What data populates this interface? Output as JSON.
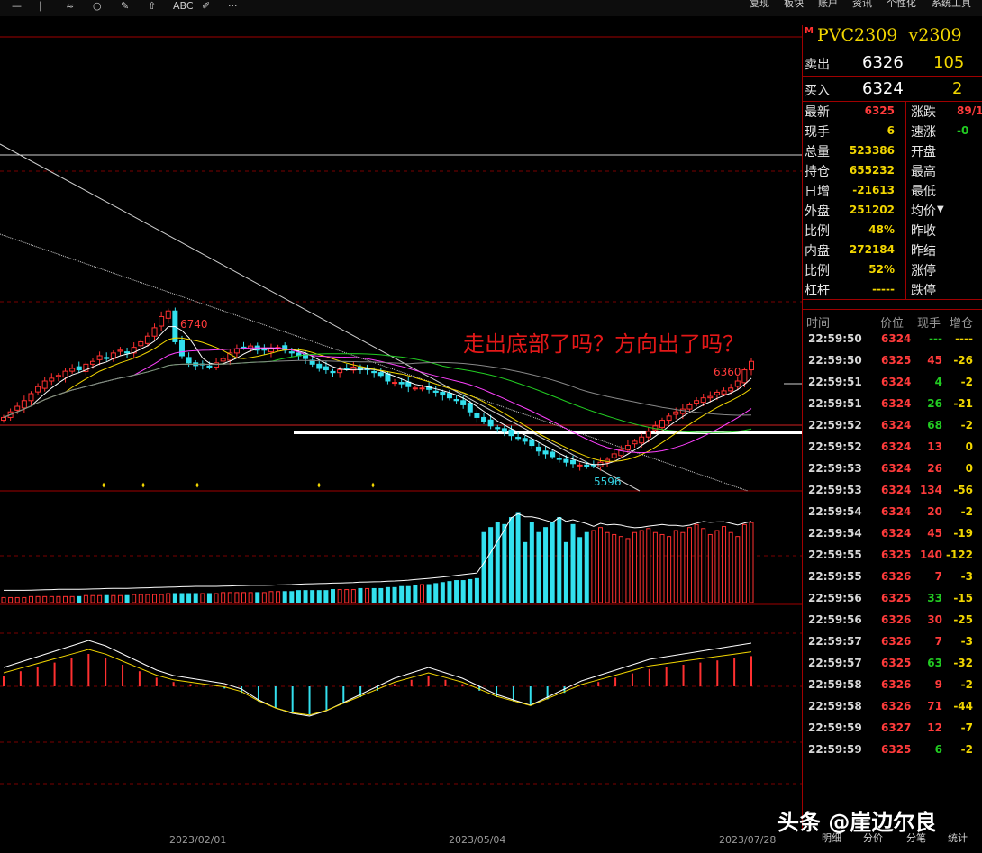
{
  "toolbar": {
    "icons": [
      "minus-icon",
      "draw-line-icon",
      "ellipse-icon",
      "wave-line-icon",
      "arrow-up-icon",
      "text-abc-icon",
      "pencil-icon",
      "more-icon"
    ],
    "abc_label": "ABC",
    "more_label": "···",
    "menu": [
      "复现",
      "板块",
      "账户",
      "资讯",
      "个性化",
      "系统工具"
    ]
  },
  "quote": {
    "flag": "M",
    "symbol": "PVC2309",
    "contract": "v2309",
    "sell_label": "卖出",
    "sell_price": "6326",
    "sell_vol": "105",
    "buy_label": "买入",
    "buy_price": "6324",
    "buy_vol": "2",
    "fields_left": [
      {
        "label": "最新",
        "value": "6325",
        "color": "#ff3b3b"
      },
      {
        "label": "现手",
        "value": "6",
        "color": "#f2d600"
      },
      {
        "label": "总量",
        "value": "523386",
        "color": "#f2d600"
      },
      {
        "label": "持仓",
        "value": "655232",
        "color": "#f2d600"
      },
      {
        "label": "日增",
        "value": "-21613",
        "color": "#f2d600"
      },
      {
        "label": "外盘",
        "value": "251202",
        "color": "#f2d600"
      },
      {
        "label": "比例",
        "value": "48%",
        "color": "#f2d600"
      },
      {
        "label": "内盘",
        "value": "272184",
        "color": "#f2d600"
      },
      {
        "label": "比例",
        "value": "52%",
        "color": "#f2d600"
      },
      {
        "label": "杠杆",
        "value": "-----",
        "color": "#f2d600"
      }
    ],
    "fields_right": [
      {
        "label": "涨跌",
        "value": "89/1",
        "color": "#ff3b3b"
      },
      {
        "label": "速涨",
        "value": "-0",
        "color": "#22cc22"
      },
      {
        "label": "开盘",
        "value": ""
      },
      {
        "label": "最高",
        "value": ""
      },
      {
        "label": "最低",
        "value": ""
      },
      {
        "label": "均价",
        "value": ""
      },
      {
        "label": "昨收",
        "value": ""
      },
      {
        "label": "昨结",
        "value": ""
      },
      {
        "label": "涨停",
        "value": ""
      },
      {
        "label": "跌停",
        "value": ""
      }
    ]
  },
  "ticks": {
    "headers": [
      "时间",
      "价位",
      "现手",
      "增仓"
    ],
    "rows": [
      {
        "time": "22:59:50",
        "price": "6324",
        "vol": "---",
        "chg": "----",
        "vc": "#22cc22",
        "cc": "#f2d600"
      },
      {
        "time": "22:59:50",
        "price": "6325",
        "vol": "45",
        "chg": "-26",
        "vc": "#ff3b3b",
        "cc": "#f2d600"
      },
      {
        "time": "22:59:51",
        "price": "6324",
        "vol": "4",
        "chg": "-2",
        "vc": "#22cc22",
        "cc": "#f2d600"
      },
      {
        "time": "22:59:51",
        "price": "6324",
        "vol": "26",
        "chg": "-21",
        "vc": "#22cc22",
        "cc": "#f2d600"
      },
      {
        "time": "22:59:52",
        "price": "6324",
        "vol": "68",
        "chg": "-2",
        "vc": "#22cc22",
        "cc": "#f2d600"
      },
      {
        "time": "22:59:52",
        "price": "6324",
        "vol": "13",
        "chg": "0",
        "vc": "#ff3b3b",
        "cc": "#f2d600"
      },
      {
        "time": "22:59:53",
        "price": "6324",
        "vol": "26",
        "chg": "0",
        "vc": "#ff3b3b",
        "cc": "#f2d600"
      },
      {
        "time": "22:59:53",
        "price": "6324",
        "vol": "134",
        "chg": "-56",
        "vc": "#ff3b3b",
        "cc": "#f2d600"
      },
      {
        "time": "22:59:54",
        "price": "6324",
        "vol": "20",
        "chg": "-2",
        "vc": "#ff3b3b",
        "cc": "#f2d600"
      },
      {
        "time": "22:59:54",
        "price": "6324",
        "vol": "45",
        "chg": "-19",
        "vc": "#ff3b3b",
        "cc": "#f2d600"
      },
      {
        "time": "22:59:55",
        "price": "6325",
        "vol": "140",
        "chg": "-122",
        "vc": "#ff3b3b",
        "cc": "#f2d600"
      },
      {
        "time": "22:59:55",
        "price": "6326",
        "vol": "7",
        "chg": "-3",
        "vc": "#ff3b3b",
        "cc": "#f2d600"
      },
      {
        "time": "22:59:56",
        "price": "6325",
        "vol": "33",
        "chg": "-15",
        "vc": "#22cc22",
        "cc": "#f2d600"
      },
      {
        "time": "22:59:56",
        "price": "6326",
        "vol": "30",
        "chg": "-25",
        "vc": "#ff3b3b",
        "cc": "#f2d600"
      },
      {
        "time": "22:59:57",
        "price": "6326",
        "vol": "7",
        "chg": "-3",
        "vc": "#ff3b3b",
        "cc": "#f2d600"
      },
      {
        "time": "22:59:57",
        "price": "6325",
        "vol": "63",
        "chg": "-32",
        "vc": "#22cc22",
        "cc": "#f2d600"
      },
      {
        "time": "22:59:58",
        "price": "6326",
        "vol": "9",
        "chg": "-2",
        "vc": "#ff3b3b",
        "cc": "#f2d600"
      },
      {
        "time": "22:59:58",
        "price": "6326",
        "vol": "71",
        "chg": "-44",
        "vc": "#ff3b3b",
        "cc": "#f2d600"
      },
      {
        "time": "22:59:59",
        "price": "6327",
        "vol": "12",
        "chg": "-7",
        "vc": "#ff3b3b",
        "cc": "#f2d600"
      },
      {
        "time": "22:59:59",
        "price": "6325",
        "vol": "6",
        "chg": "-2",
        "vc": "#22cc22",
        "cc": "#f2d600"
      }
    ]
  },
  "bottom": {
    "dates": [
      "2023/02/01",
      "2023/05/04",
      "2023/07/28"
    ],
    "tabs": [
      "明细",
      "分价",
      "分笔",
      "统计"
    ]
  },
  "annotation": "走出底部了吗？方向出了吗？",
  "watermark": "头条 @崖边尔良",
  "chart_data": {
    "type": "candlestick",
    "title": "PVC2309",
    "labels": {
      "high": "6740",
      "low": "5596",
      "last_high": "6360"
    },
    "close": [
      5960,
      6000,
      6040,
      6080,
      6130,
      6180,
      6220,
      6240,
      6260,
      6290,
      6310,
      6300,
      6340,
      6360,
      6400,
      6380,
      6420,
      6440,
      6420,
      6460,
      6500,
      6540,
      6600,
      6680,
      6720,
      6500,
      6400,
      6350,
      6330,
      6340,
      6320,
      6350,
      6380,
      6420,
      6450,
      6460,
      6470,
      6440,
      6440,
      6450,
      6460,
      6440,
      6420,
      6400,
      6380,
      6340,
      6310,
      6300,
      6280,
      6300,
      6310,
      6320,
      6300,
      6300,
      6280,
      6260,
      6220,
      6210,
      6200,
      6180,
      6170,
      6170,
      6160,
      6140,
      6120,
      6100,
      6080,
      6050,
      6000,
      5960,
      5930,
      5900,
      5880,
      5860,
      5830,
      5810,
      5790,
      5760,
      5720,
      5700,
      5680,
      5660,
      5640,
      5630,
      5620,
      5610,
      5620,
      5640,
      5660,
      5700,
      5730,
      5760,
      5790,
      5820,
      5860,
      5900,
      5940,
      5970,
      6000,
      6020,
      6050,
      6080,
      6100,
      6110,
      6140,
      6150,
      6170,
      6220,
      6300,
      6360
    ],
    "volume_k": [
      5,
      5,
      5,
      5,
      6,
      6,
      6,
      6,
      6,
      6,
      6,
      6,
      7,
      7,
      7,
      7,
      7,
      7,
      7,
      8,
      8,
      8,
      8,
      8,
      9,
      9,
      9,
      9,
      9,
      9,
      9,
      9,
      10,
      10,
      10,
      10,
      10,
      10,
      10,
      11,
      11,
      11,
      11,
      12,
      12,
      12,
      12,
      12,
      13,
      13,
      13,
      13,
      14,
      14,
      14,
      14,
      15,
      15,
      16,
      16,
      17,
      18,
      18,
      19,
      20,
      21,
      22,
      22,
      23,
      24,
      70,
      75,
      80,
      78,
      85,
      90,
      60,
      80,
      70,
      75,
      80,
      85,
      60,
      78,
      65,
      70,
      72,
      75,
      70,
      68,
      66,
      64,
      70,
      72,
      74,
      70,
      68,
      66,
      72,
      70,
      75,
      78,
      74,
      68,
      72,
      76,
      70,
      66,
      78,
      80
    ],
    "macd": [
      10,
      14,
      18,
      22,
      26,
      30,
      26,
      20,
      14,
      8,
      4,
      2,
      0,
      -2,
      -6,
      -14,
      -20,
      -24,
      -26,
      -22,
      -16,
      -10,
      -4,
      2,
      6,
      10,
      6,
      2,
      -4,
      -10,
      -14,
      -18,
      -12,
      -6,
      0,
      4,
      8,
      12,
      16,
      18,
      20,
      22,
      24,
      26,
      28
    ],
    "price_range": [
      5500,
      6850
    ]
  }
}
